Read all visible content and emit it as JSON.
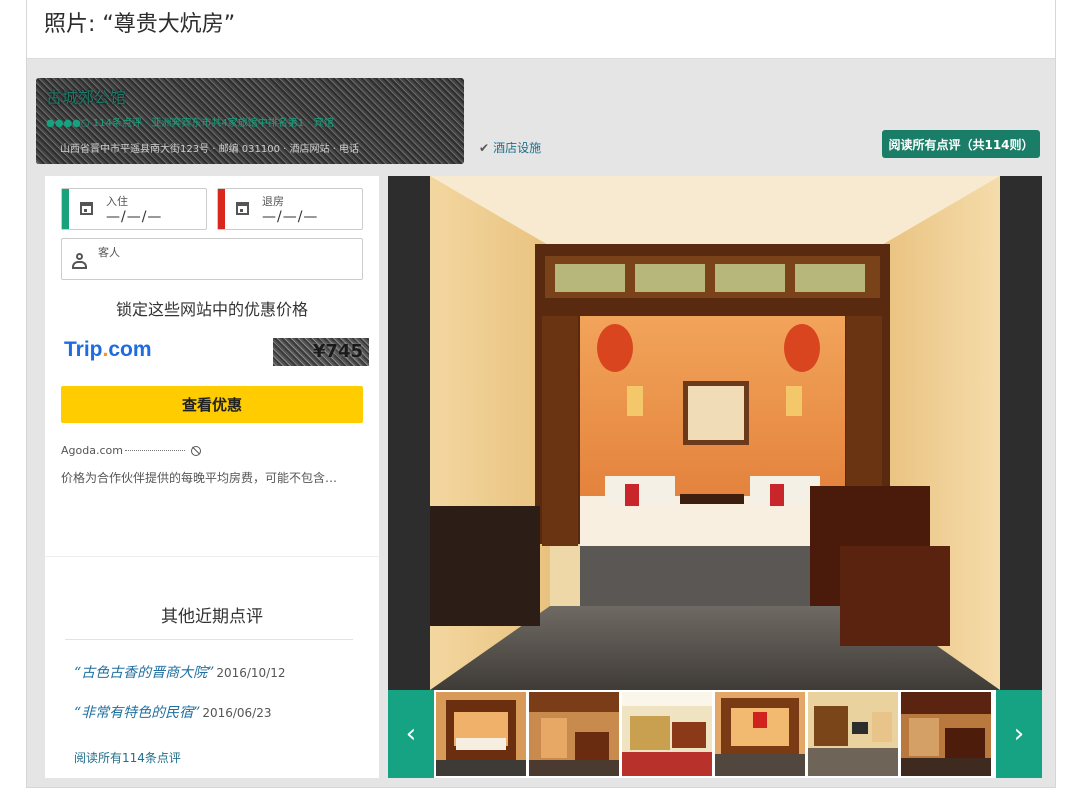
{
  "header": {
    "title": "照片: “尊贵大炕房”"
  },
  "hotel": {
    "name": "古城郊公馆",
    "meta": "●●●●○ 114条点评 · 亚洲奔宾东市共4家旅馆中排名第1 · 宾馆",
    "address": "山西省晋中市平遥县南大街123号 · 邮编 031100 · 酒店网站 · 电话",
    "amenities_label": "酒店设施",
    "read_all_reviews": "阅读所有点评（共114则）"
  },
  "booking": {
    "checkin": {
      "label": "入住",
      "value": "—/—/—"
    },
    "checkout": {
      "label": "退房",
      "value": "—/—/—"
    },
    "guests": {
      "label": "客人"
    },
    "lock_title": "锁定这些网站中的优惠价格",
    "provider": {
      "name_main": "Trip",
      "name_dot": ".",
      "name_tail": "com",
      "price": "¥745"
    },
    "deal_button": "查看优惠",
    "agoda": "Agoda.com",
    "disclaimer": "价格为合作伙伴提供的每晚平均房费，可能不包含…"
  },
  "recent_reviews": {
    "title": "其他近期点评",
    "items": [
      {
        "quote": "“古色古香的晋商大院”",
        "date": "2016/10/12"
      },
      {
        "quote": "“非常有特色的民宿”",
        "date": "2016/06/23"
      }
    ],
    "read_all": "阅读所有114条点评"
  },
  "gallery": {
    "prev": "‹",
    "next": "›",
    "thumbnail_count": 6
  },
  "colors": {
    "brand_green": "#1a7d68",
    "arrow_green": "#16a383",
    "checkin_bar": "#1aa37a",
    "checkout_bar": "#d8281e",
    "deal_yellow": "#ffcc00",
    "trip_blue": "#1d6ce0"
  }
}
